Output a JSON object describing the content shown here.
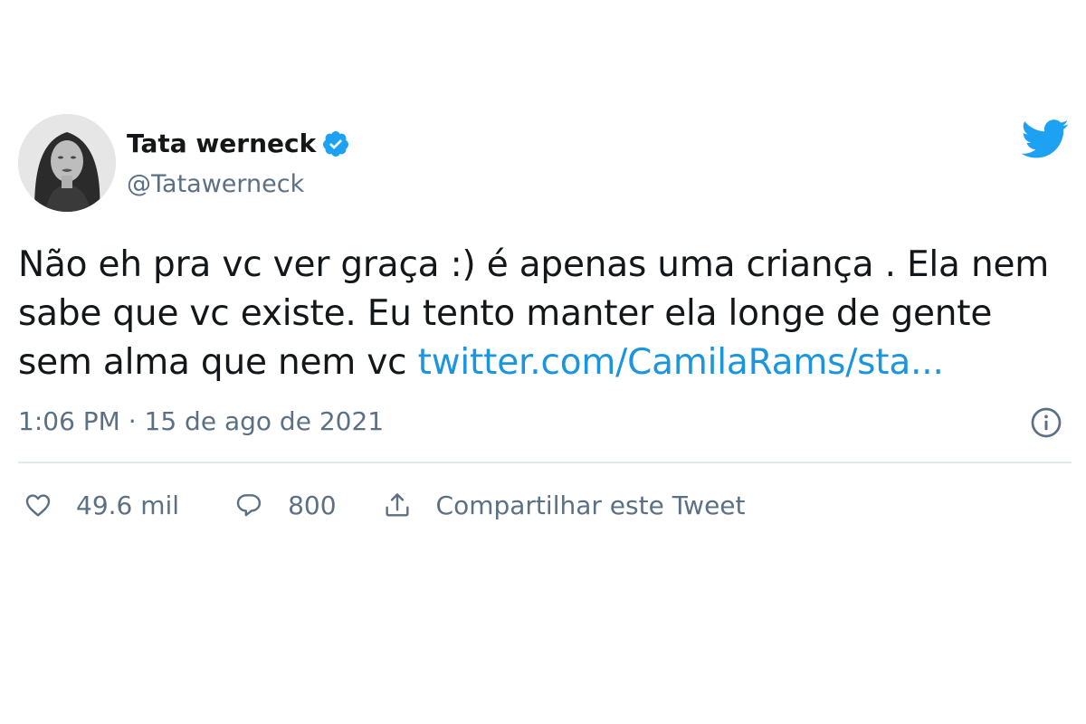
{
  "author": {
    "name": "Tata werneck",
    "handle": "@Tatawerneck",
    "verified": true
  },
  "tweet": {
    "lines": [
      "Não eh pra vc ver graça :) é apenas uma criança . Ela nem",
      "sabe que vc existe. Eu tento manter ela longe de gente",
      "sem alma que nem vc "
    ],
    "link_text": "twitter.com/CamilaRams/sta...",
    "timestamp": "1:06 PM · 15 de ago de 2021"
  },
  "actions": {
    "like_count": "49.6 mil",
    "reply_count": "800",
    "share_label": "Compartilhar este Tweet"
  },
  "colors": {
    "twitter_blue": "#1da1f2",
    "link_blue": "#1b95e0",
    "text_primary": "#14171a",
    "text_secondary": "#5b7083",
    "divider": "#e1e8ed"
  },
  "icons": {
    "brand": "twitter-bird-icon",
    "verified": "verified-badge-icon",
    "info": "info-icon",
    "like": "heart-icon",
    "reply": "reply-bubble-icon",
    "share": "share-icon"
  }
}
